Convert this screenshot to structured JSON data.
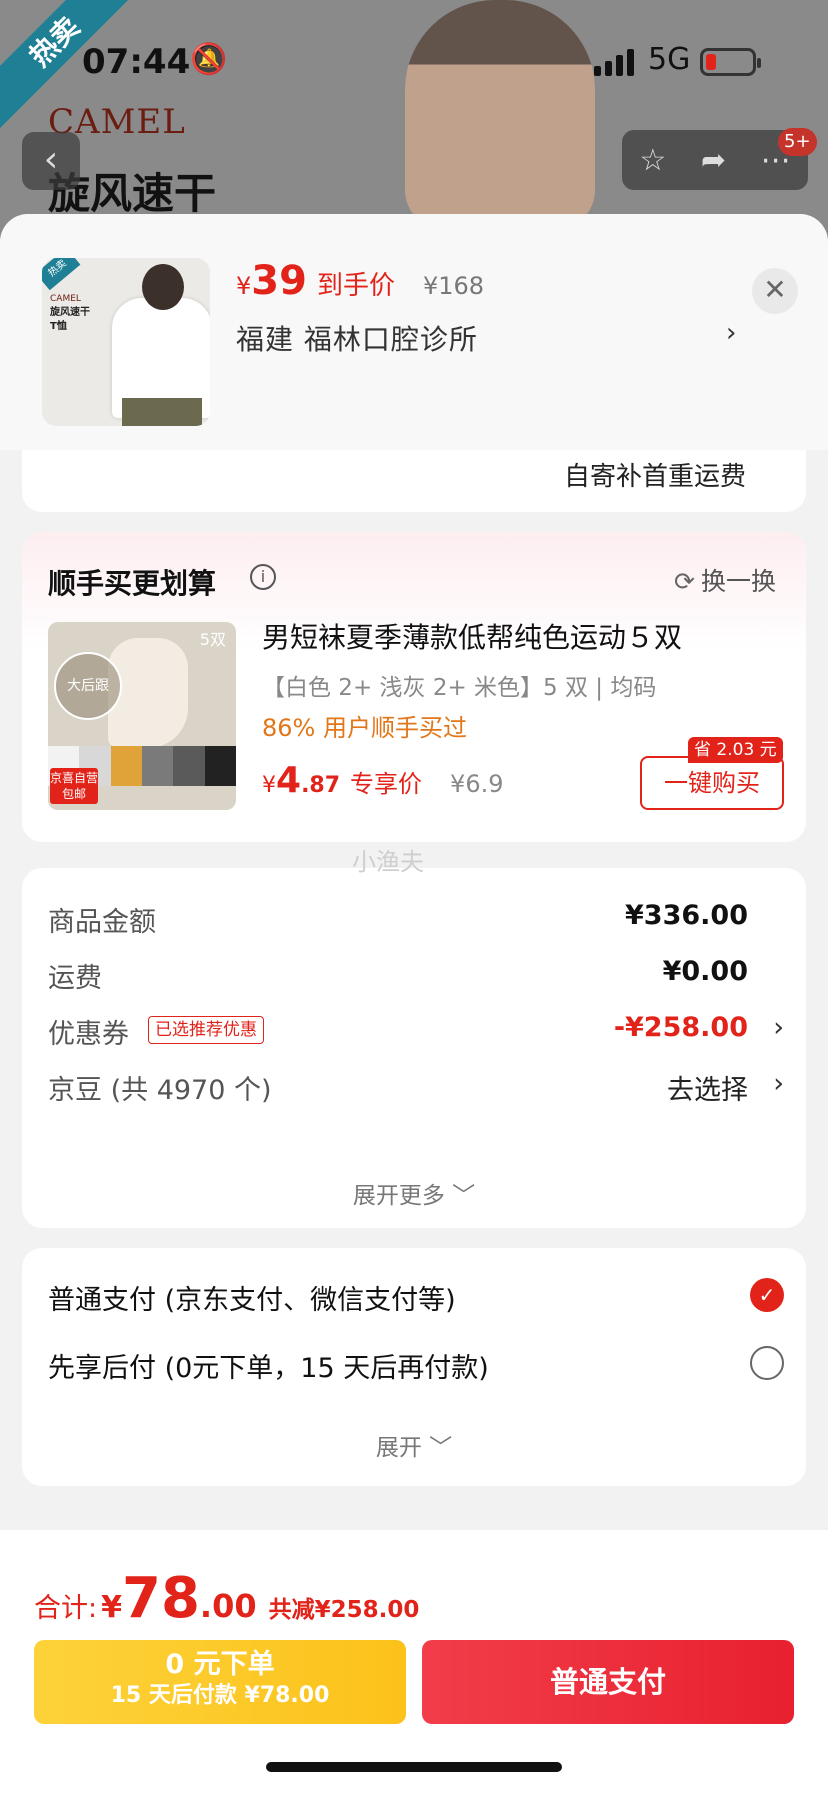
{
  "status_bar": {
    "time": "07:44",
    "network": "5G"
  },
  "background_page": {
    "ribbon": "热卖",
    "brand": "CAMEL",
    "title": "旋风速干",
    "cart_badge": "5+"
  },
  "sheet_header": {
    "image_tag": "热卖",
    "image_brand": "CAMEL",
    "image_text": "旋风速干\nT恤",
    "price_symbol": "¥",
    "price": "39",
    "price_label": "到手价",
    "original_price": "¥168",
    "address": "福建  福林口腔诊所"
  },
  "shipping": {
    "text": "自寄补首重运费"
  },
  "addon": {
    "title": "顺手买更划算",
    "refresh_label": "换一换",
    "item": {
      "name": "男短袜夏季薄款低帮纯色运动５双",
      "spec": "【白色 2+ 浅灰 2+ 米色】5 双  |  均码",
      "stat": "86% 用户顺手买过",
      "price_symbol": "¥",
      "price_int": "4",
      "price_dec": ".87",
      "price_label": "专享价",
      "original_price": "¥6.9",
      "save_badge": "省 2.03 元",
      "buy_label": "一键购买",
      "image_badge": "大后跟",
      "image_count": "5双",
      "image_tag": "京喜自营 包邮"
    },
    "colors": [
      "#f2f2f2",
      "#d8d8d8",
      "#e0a33a",
      "#7a7a7a",
      "#5a5a5a",
      "#222222"
    ]
  },
  "watermark": "小渔夫",
  "summary": {
    "rows": [
      {
        "label": "商品金额",
        "value": "¥336.00"
      },
      {
        "label": "运费",
        "value": "¥0.00"
      },
      {
        "label": "优惠券",
        "tag": "已选推荐优惠",
        "value": "-¥258.00"
      },
      {
        "label": "京豆 (共 4970 个)",
        "value": "去选择"
      }
    ],
    "expand_label": "展开更多 ﹀"
  },
  "payment": {
    "options": [
      {
        "label": "普通支付 (京东支付、微信支付等)",
        "selected": true
      },
      {
        "label": "先享后付 (0元下单，15 天后再付款)",
        "selected": false
      }
    ],
    "expand_label": "展开 ﹀"
  },
  "footer": {
    "total_label": "合计:",
    "total_symbol": "¥",
    "total_int": "78",
    "total_dec": ".00",
    "total_saved": "共减¥258.00",
    "zero_title": "0 元下单",
    "zero_sub": "15 天后付款 ¥78.00",
    "pay_label": "普通支付"
  },
  "colors": {
    "accent": "#e2231a",
    "yellow": "#fcc21a",
    "orange": "#e27719"
  }
}
